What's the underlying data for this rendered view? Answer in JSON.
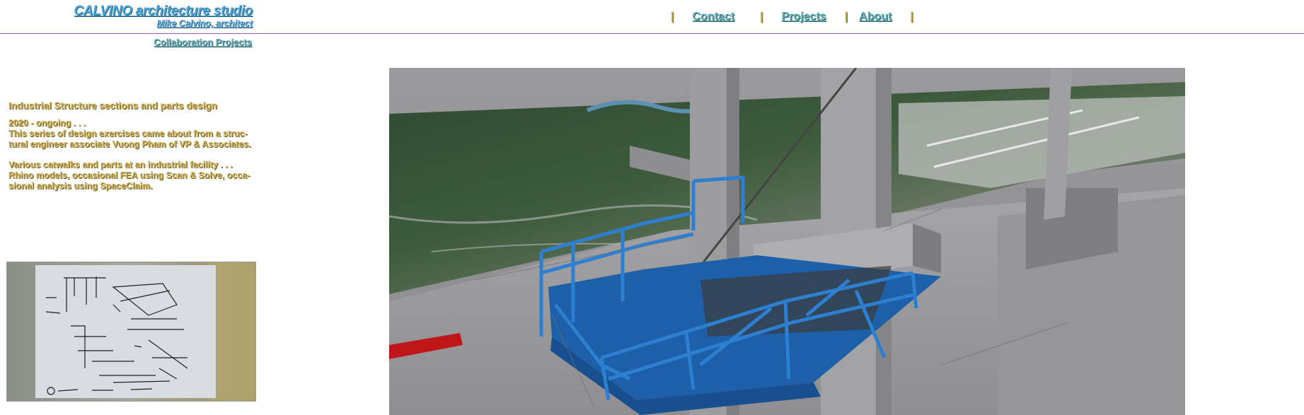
{
  "header": {
    "studio_name": "CALVINO architecture studio",
    "architect": "Mike Calvino, architect",
    "separator": "|",
    "nav": [
      {
        "label": "Contact"
      },
      {
        "label": "Projects"
      },
      {
        "label": "About"
      }
    ]
  },
  "sidebar": {
    "section_link": "Collaboration Projects",
    "heading": "Industrial Structure sections and parts design",
    "para1_line1": "2020 - ongoing . . .",
    "para1_line2": "This series of design exercises came about from a struc-",
    "para1_line3": "tural engineer associate Vuong Pham of VP & Associates.",
    "para2_line1": "Various catwalks and parts at an industrial facility . . .",
    "para2_line2": "Rhino models, occasional FEA using Scan & Solve, occa-",
    "para2_line3": "sional analysis using SpaceClaim."
  },
  "images": {
    "sketch_alt": "hand sketch of catwalk frame",
    "render_alt": "3D render of blue catwalk platform over aerial site"
  }
}
